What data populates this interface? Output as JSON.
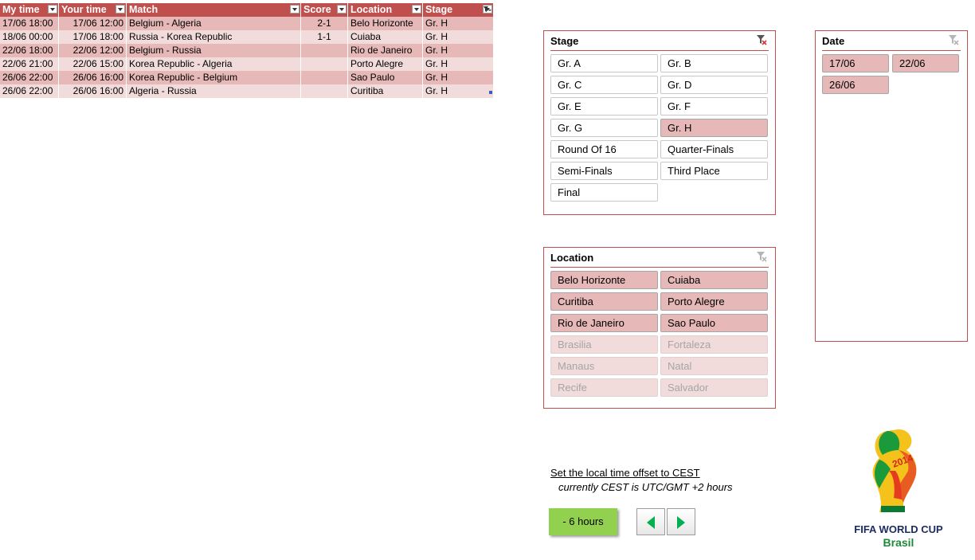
{
  "table": {
    "headers": [
      "My time",
      "Your time",
      "Match",
      "Score",
      "Location",
      "Stage"
    ],
    "rows": [
      [
        "17/06 18:00",
        "17/06 12:00",
        "Belgium - Algeria",
        "2-1",
        "Belo Horizonte",
        "Gr. H"
      ],
      [
        "18/06 00:00",
        "17/06 18:00",
        "Russia - Korea Republic",
        "1-1",
        "Cuiaba",
        "Gr. H"
      ],
      [
        "22/06 18:00",
        "22/06 12:00",
        "Belgium - Russia",
        "",
        "Rio de Janeiro",
        "Gr. H"
      ],
      [
        "22/06 21:00",
        "22/06 15:00",
        "Korea Republic - Algeria",
        "",
        "Porto Alegre",
        "Gr. H"
      ],
      [
        "26/06 22:00",
        "26/06 16:00",
        "Korea Republic - Belgium",
        "",
        "Sao Paulo",
        "Gr. H"
      ],
      [
        "26/06 22:00",
        "26/06 16:00",
        "Algeria - Russia",
        "",
        "Curitiba",
        "Gr. H"
      ]
    ]
  },
  "stage_slicer": {
    "title": "Stage",
    "items": [
      {
        "label": "Gr. A",
        "state": "normal"
      },
      {
        "label": "Gr. B",
        "state": "normal"
      },
      {
        "label": "Gr. C",
        "state": "normal"
      },
      {
        "label": "Gr. D",
        "state": "normal"
      },
      {
        "label": "Gr. E",
        "state": "normal"
      },
      {
        "label": "Gr. F",
        "state": "normal"
      },
      {
        "label": "Gr. G",
        "state": "normal"
      },
      {
        "label": "Gr. H",
        "state": "selected"
      },
      {
        "label": "Round Of 16",
        "state": "normal"
      },
      {
        "label": "Quarter-Finals",
        "state": "normal"
      },
      {
        "label": "Semi-Finals",
        "state": "normal"
      },
      {
        "label": "Third Place",
        "state": "normal"
      },
      {
        "label": "Final",
        "state": "normal"
      }
    ]
  },
  "location_slicer": {
    "title": "Location",
    "items": [
      {
        "label": "Belo Horizonte",
        "state": "selected"
      },
      {
        "label": "Cuiaba",
        "state": "selected"
      },
      {
        "label": "Curitiba",
        "state": "selected"
      },
      {
        "label": "Porto Alegre",
        "state": "selected"
      },
      {
        "label": "Rio de Janeiro",
        "state": "selected"
      },
      {
        "label": "Sao Paulo",
        "state": "selected"
      },
      {
        "label": "Brasilia",
        "state": "dim"
      },
      {
        "label": "Fortaleza",
        "state": "dim"
      },
      {
        "label": "Manaus",
        "state": "dim"
      },
      {
        "label": "Natal",
        "state": "dim"
      },
      {
        "label": "Recife",
        "state": "dim"
      },
      {
        "label": "Salvador",
        "state": "dim"
      }
    ]
  },
  "date_slicer": {
    "title": "Date",
    "items": [
      {
        "label": "17/06",
        "state": "selected"
      },
      {
        "label": "22/06",
        "state": "selected"
      },
      {
        "label": "26/06",
        "state": "selected"
      }
    ]
  },
  "offset": {
    "title": "Set the local time offset to CEST",
    "subtitle": "currently CEST is UTC/GMT +2 hours",
    "button_label": "- 6 hours"
  },
  "logo": {
    "line1": "FIFA WORLD CUP",
    "line2": "Brasil",
    "year": "2014"
  },
  "colors": {
    "header": "#c0504d",
    "row_dark": "#e6b8b7",
    "row_light": "#f2dcdb",
    "button_green": "#92d050",
    "arrow_green": "#00b050"
  },
  "icons": [
    "filter-dropdown-icon",
    "filtered-dropdown-icon",
    "clear-filter-icon",
    "left-arrow-icon",
    "right-arrow-icon"
  ]
}
